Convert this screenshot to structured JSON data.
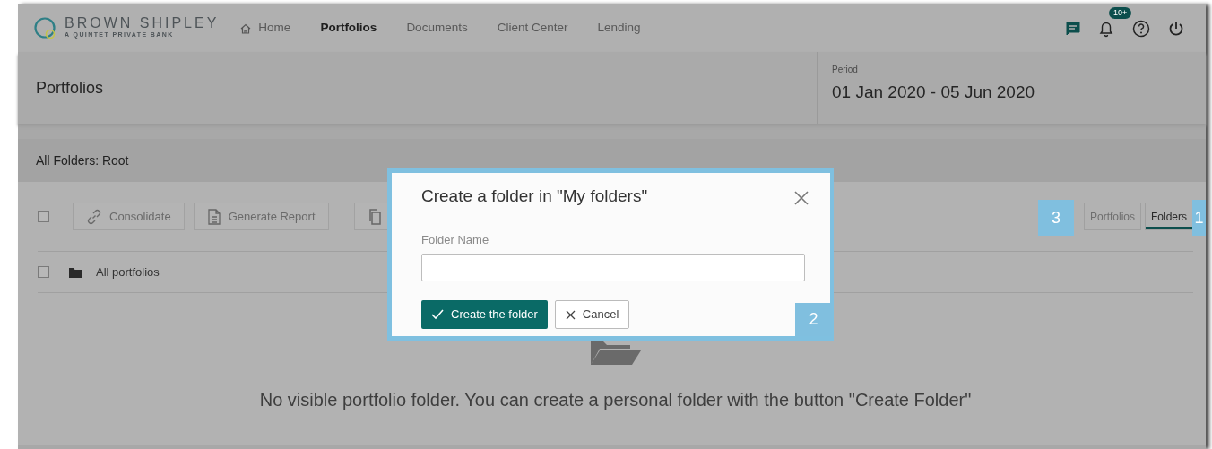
{
  "brand": {
    "name": "BROWN SHIPLEY",
    "tagline": "A QUINTET PRIVATE BANK"
  },
  "nav": [
    {
      "label": "Home",
      "kind": "home",
      "selected": false
    },
    {
      "label": "Portfolios",
      "kind": "link",
      "selected": true
    },
    {
      "label": "Documents",
      "kind": "link",
      "selected": false
    },
    {
      "label": "Client Center",
      "kind": "link",
      "selected": false
    },
    {
      "label": "Lending",
      "kind": "link",
      "selected": false
    }
  ],
  "notifications": {
    "count": "10+"
  },
  "page_header": {
    "title": "Portfolios",
    "period_label": "Period",
    "period": "01 Jan 2020 - 05 Jun 2020"
  },
  "panel": {
    "title": "All Folders: Root",
    "select_all": {
      "checked": false
    },
    "toolbar": [
      {
        "label": "Consolidate",
        "kind": "link"
      },
      {
        "label": "Generate Report",
        "kind": "report"
      },
      {
        "kind": "copy"
      }
    ],
    "view_toggle": [
      {
        "label": "Portfolios",
        "selected": false
      },
      {
        "label": "Folders",
        "selected": true
      }
    ],
    "rows": [
      {
        "label": "All portfolios",
        "checked": false
      }
    ],
    "empty_message": "No visible portfolio folder. You can create a personal folder with the button \"Create Folder\""
  },
  "dialog": {
    "title": "Create a folder in \"My folders\"",
    "field_label": "Folder Name",
    "buttons": [
      {
        "label": "Create the folder",
        "kind": "primary"
      },
      {
        "label": "Cancel",
        "kind": "secondary"
      }
    ]
  },
  "callouts": [
    "3",
    "1",
    "2"
  ]
}
